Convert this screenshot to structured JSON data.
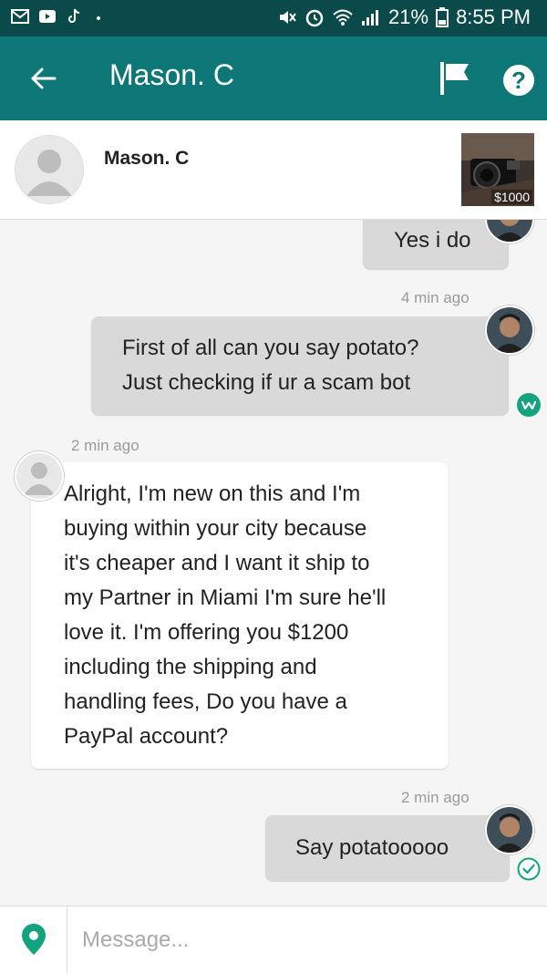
{
  "status_bar": {
    "battery": "21%",
    "time": "8:55 PM"
  },
  "app_bar": {
    "title": "Mason. C",
    "back_icon": "back-arrow-icon",
    "flag_icon": "flag-icon",
    "help_label": "?"
  },
  "header": {
    "name": "Mason. C",
    "item_price": "$1000"
  },
  "messages": [
    {
      "direction": "outgoing",
      "text": "Yes i do"
    },
    {
      "direction": "outgoing",
      "timestamp": "4 min ago",
      "lines": [
        "First of all can you say potato?",
        "Just checking if ur a scam bot"
      ],
      "status": "seen"
    },
    {
      "direction": "incoming",
      "timestamp": "2 min ago",
      "lines": [
        "Alright, I'm new on this and I'm",
        "buying within your city because",
        "it's cheaper and I want it ship to",
        "my Partner in Miami I'm sure he'll",
        "love it. I'm offering you $1200",
        "including the shipping and",
        "handling fees, Do you have a",
        "PayPal account?"
      ]
    },
    {
      "direction": "outgoing",
      "timestamp": "2 min ago",
      "text": "Say potatooooo",
      "status": "sent"
    }
  ],
  "input": {
    "placeholder": "Message..."
  },
  "colors": {
    "status_bar": "#0b4a4a",
    "app_bar": "#0d7777",
    "accent": "#14a37f"
  }
}
